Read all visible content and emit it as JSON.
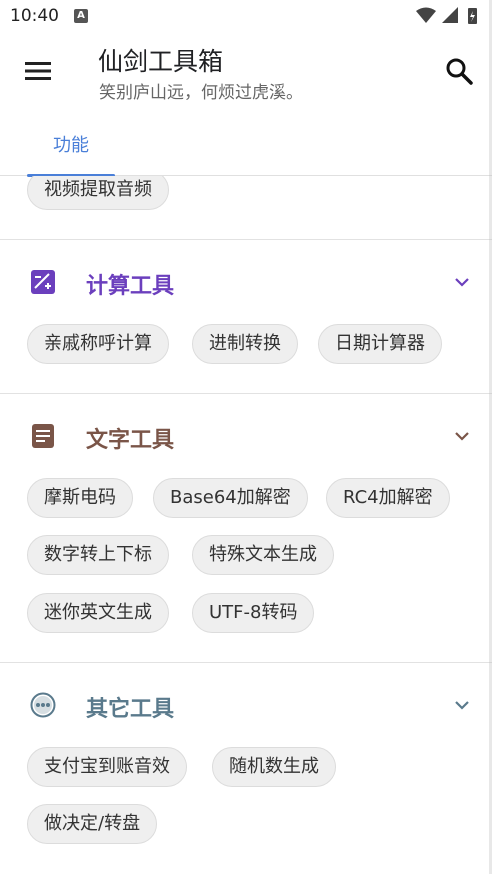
{
  "status": {
    "time": "10:40",
    "a_badge": "A"
  },
  "header": {
    "title": "仙剑工具箱",
    "subtitle": "笑别庐山远，何烦过虎溪。"
  },
  "tabs": [
    {
      "label": "功能"
    }
  ],
  "colors": {
    "accent": "#4a7fd8",
    "calc": "#6b3fbd",
    "text_tools": "#7a5548",
    "other": "#5a7a8c"
  },
  "partial_section": {
    "chips": [
      "视频提取音频"
    ]
  },
  "sections": [
    {
      "title": "计算工具",
      "icon": "calculator-icon",
      "chips": [
        "亲戚称呼计算",
        "进制转换",
        "日期计算器"
      ]
    },
    {
      "title": "文字工具",
      "icon": "document-icon",
      "chips": [
        "摩斯电码",
        "Base64加解密",
        "RC4加解密",
        "数字转上下标",
        "特殊文本生成",
        "迷你英文生成",
        "UTF-8转码"
      ]
    },
    {
      "title": "其它工具",
      "icon": "more-horiz-circle-icon",
      "chips": [
        "支付宝到账音效",
        "随机数生成",
        "做决定/转盘"
      ]
    }
  ]
}
